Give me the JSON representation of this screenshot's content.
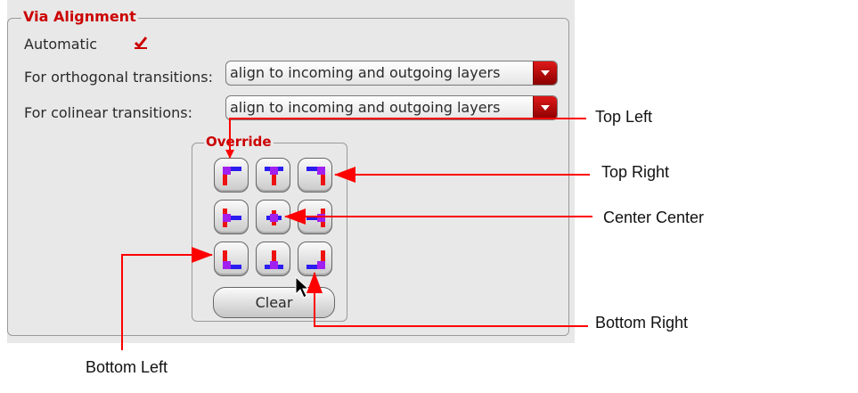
{
  "via_alignment": {
    "title": "Via Alignment",
    "automatic_label": "Automatic",
    "automatic_checked": true,
    "orthogonal_label": "For orthogonal transitions:",
    "orthogonal_value": "align to incoming and outgoing layers",
    "colinear_label": "For colinear transitions:",
    "colinear_value": "align to incoming and outgoing layers"
  },
  "override": {
    "title": "Override",
    "buttons": [
      {
        "icon": "via-top-left-icon"
      },
      {
        "icon": "via-top-center-icon"
      },
      {
        "icon": "via-top-right-icon"
      },
      {
        "icon": "via-center-left-icon"
      },
      {
        "icon": "via-center-center-icon"
      },
      {
        "icon": "via-center-right-icon"
      },
      {
        "icon": "via-bottom-left-icon"
      },
      {
        "icon": "via-bottom-center-icon"
      },
      {
        "icon": "via-bottom-right-icon"
      }
    ],
    "clear_label": "Clear"
  },
  "callouts": {
    "top_left": "Top Left",
    "top_right": "Top Right",
    "center_center": "Center Center",
    "bottom_right": "Bottom Right",
    "bottom_left": "Bottom Left"
  },
  "colors": {
    "accent": "#cc0000",
    "via_blue": "#2b1cf0",
    "via_purple": "#a020f0",
    "via_red": "#ee1111",
    "arrow": "#ff0000"
  }
}
